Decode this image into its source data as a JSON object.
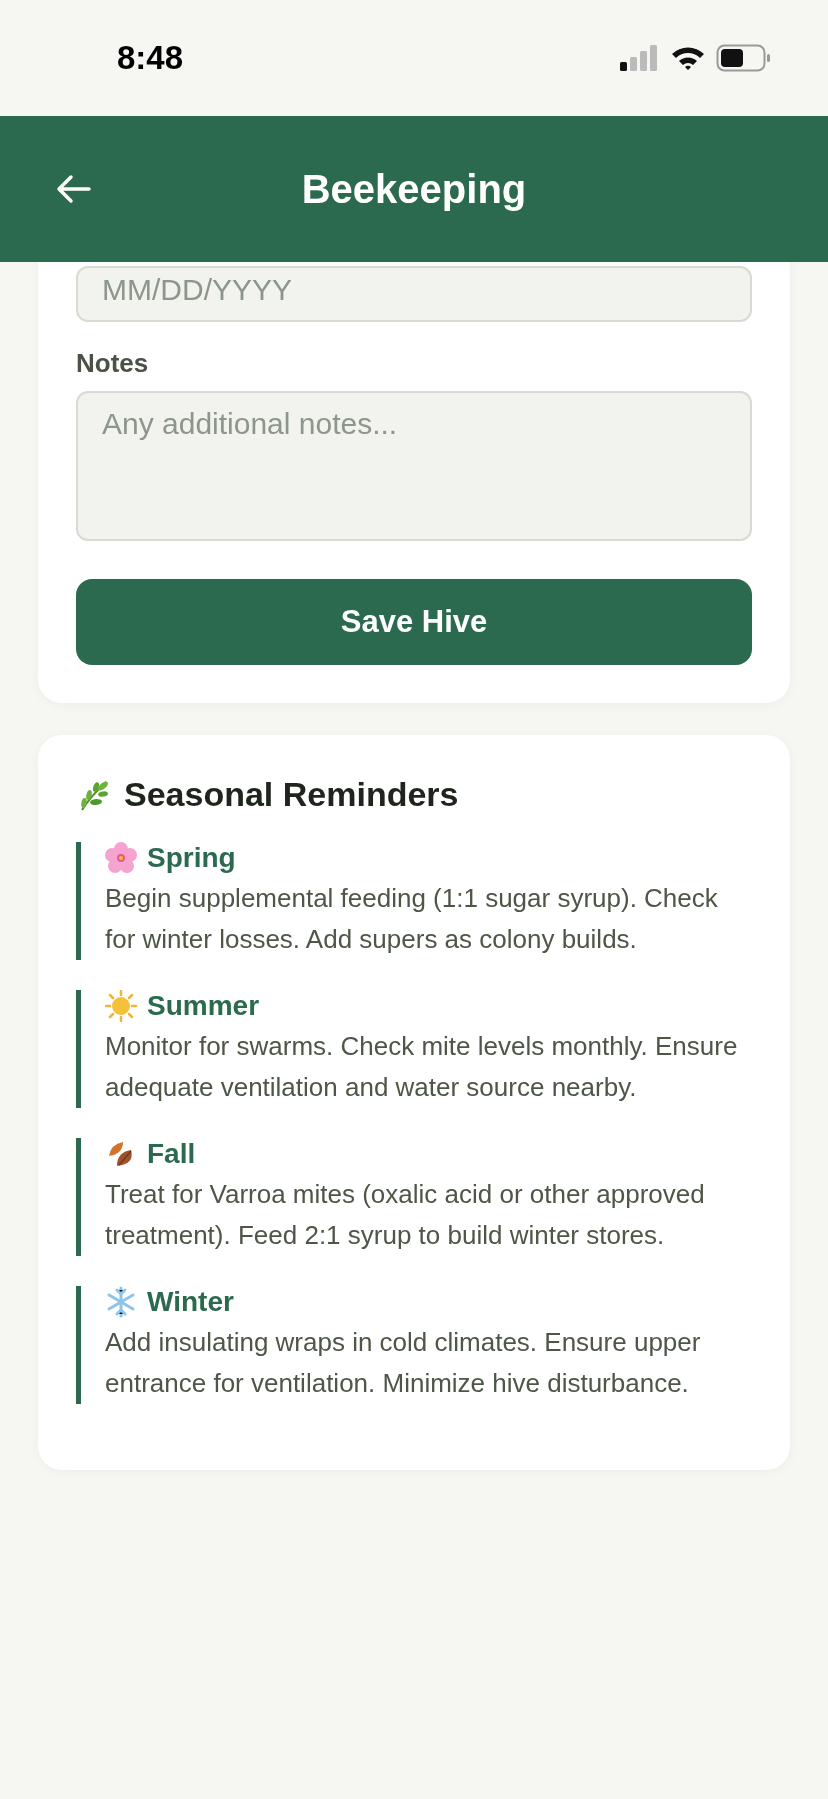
{
  "status_bar": {
    "time": "8:48"
  },
  "header": {
    "title": "Beekeeping"
  },
  "hive_form": {
    "date_field": {
      "placeholder": "MM/DD/YYYY"
    },
    "notes_label": "Notes",
    "notes_field": {
      "placeholder": "Any additional notes..."
    },
    "save_button": "Save Hive"
  },
  "seasonal_reminders": {
    "title": "Seasonal Reminders",
    "items": [
      {
        "kind": "spring",
        "name": "Spring",
        "text": "Begin supplemental feeding (1:1 sugar syrup). Check for winter losses. Add supers as colony builds."
      },
      {
        "kind": "summer",
        "name": "Summer",
        "text": "Monitor for swarms. Check mite levels monthly. Ensure adequate ventilation and water source nearby."
      },
      {
        "kind": "fall",
        "name": "Fall",
        "text": "Treat for Varroa mites (oxalic acid or other approved treatment). Feed 2:1 syrup to build winter stores."
      },
      {
        "kind": "winter",
        "name": "Winter",
        "text": "Add insulating wraps in cold climates. Ensure upper entrance for ventilation. Minimize hive disturbance."
      }
    ]
  }
}
